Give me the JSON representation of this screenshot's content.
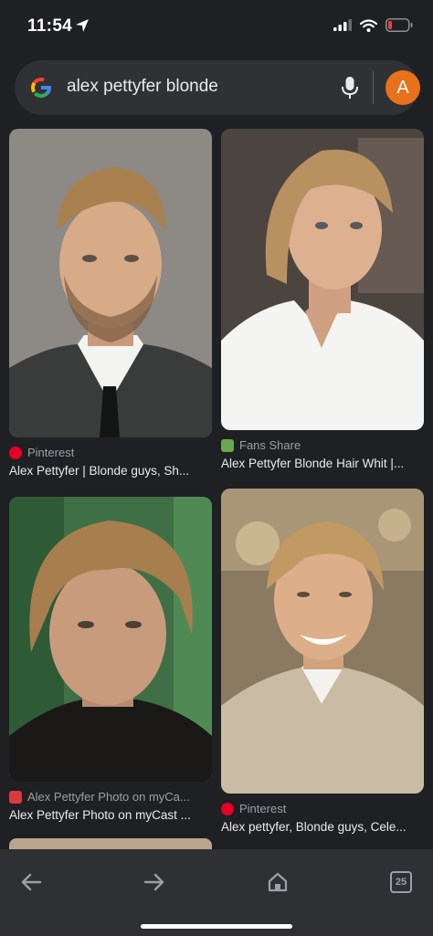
{
  "status_bar": {
    "time": "11:54",
    "battery_color": "#e2453c"
  },
  "search": {
    "query": "alex pettyfer blonde",
    "avatar_letter": "A",
    "avatar_color": "#e8711c"
  },
  "results": [
    {
      "source": "Pinterest",
      "caption": "Alex Pettyfer | Blonde guys, Sh...",
      "source_icon": "pinterest-icon",
      "source_icon_color": "#e60023"
    },
    {
      "source": "Fans Share",
      "caption": "Alex Pettyfer Blonde Hair Whit |...",
      "source_icon": "fansshare-icon",
      "source_icon_color": "#6aa84f"
    },
    {
      "source": "Alex Pettyfer Photo on myCa...",
      "caption": "Alex Pettyfer Photo on myCast ...",
      "source_icon": "mycast-icon",
      "source_icon_color": "#d93a3a"
    },
    {
      "source": "Pinterest",
      "caption": "Alex pettyfer, Blonde guys, Cele...",
      "source_icon": "pinterest-icon",
      "source_icon_color": "#e60023"
    }
  ],
  "toolbar": {
    "tab_count": "25"
  }
}
